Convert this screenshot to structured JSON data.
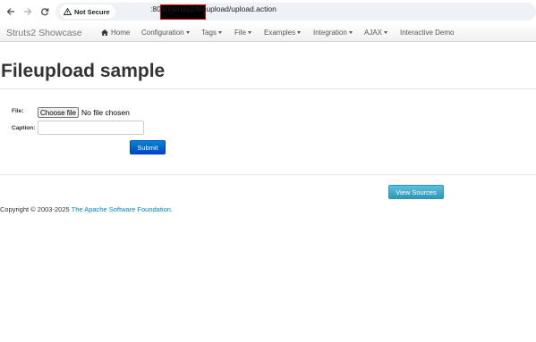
{
  "browser": {
    "security_label": "Not Secure",
    "url_visible": ":8080/struts2/fileupload/upload.action"
  },
  "navbar": {
    "brand": "Struts2 Showcase",
    "items": [
      {
        "label": "Home",
        "icon": "home-icon",
        "dropdown": false
      },
      {
        "label": "Configuration",
        "dropdown": true
      },
      {
        "label": "Tags",
        "dropdown": true
      },
      {
        "label": "File",
        "dropdown": true
      },
      {
        "label": "Examples",
        "dropdown": true
      },
      {
        "label": "Integration",
        "dropdown": true
      },
      {
        "label": "AJAX",
        "dropdown": true
      },
      {
        "label": "Interactive Demo",
        "dropdown": false
      }
    ]
  },
  "page": {
    "title": "Fileupload sample"
  },
  "form": {
    "file_label": "File:",
    "file_button": "Choose file",
    "file_status": "No file chosen",
    "caption_label": "Caption:",
    "caption_value": "",
    "submit_label": "Submit"
  },
  "view_sources_label": "View Sources",
  "footer": {
    "text": "Copyright © 2003-2025 ",
    "link": "The Apache Software Foundation."
  },
  "colors": {
    "link": "#0088cc",
    "submit": "#0044cc",
    "view_sources": "#2f96b4",
    "redaction_border": "#e00000"
  }
}
